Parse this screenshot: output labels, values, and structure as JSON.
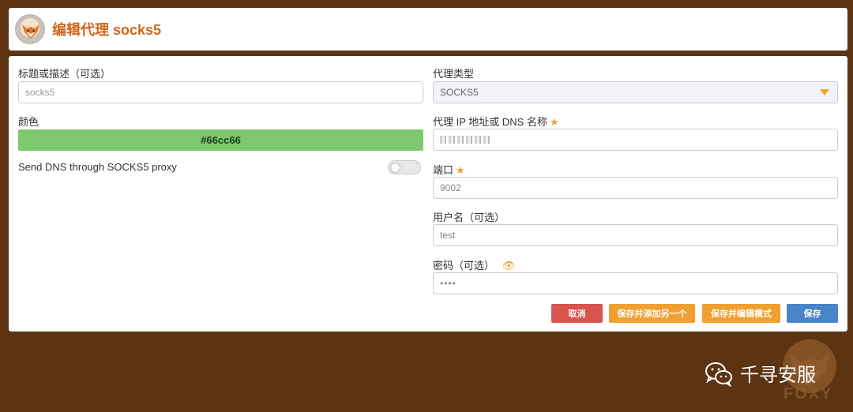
{
  "header": {
    "title": "编辑代理 socks5"
  },
  "left": {
    "title_label": "标题或描述（可选）",
    "title_value": "socks5",
    "color_label": "颜色",
    "color_value": "#66cc66",
    "dns_label": "Send DNS through SOCKS5 proxy",
    "dns_toggle": "Off"
  },
  "right": {
    "type_label": "代理类型",
    "type_value": "SOCKS5",
    "host_label": "代理 IP 地址或 DNS 名称",
    "host_value": "",
    "port_label": "端口",
    "port_value": "9002",
    "user_label": "用户名（可选）",
    "user_value": "test",
    "pass_label": "密码（可选）",
    "pass_value": "••••"
  },
  "buttons": {
    "cancel": "取消",
    "save_add": "保存并添加另一个",
    "save_edit": "保存并编辑模式",
    "save": "保存"
  },
  "watermark": {
    "text": "千寻安服",
    "foxy": "FOXY"
  },
  "colors": {
    "accent": "#d0671c",
    "orange": "#f0a030",
    "danger": "#d9534f",
    "primary": "#4a84c8",
    "bg": "#5c3412",
    "swatch": "#7dc86f"
  }
}
